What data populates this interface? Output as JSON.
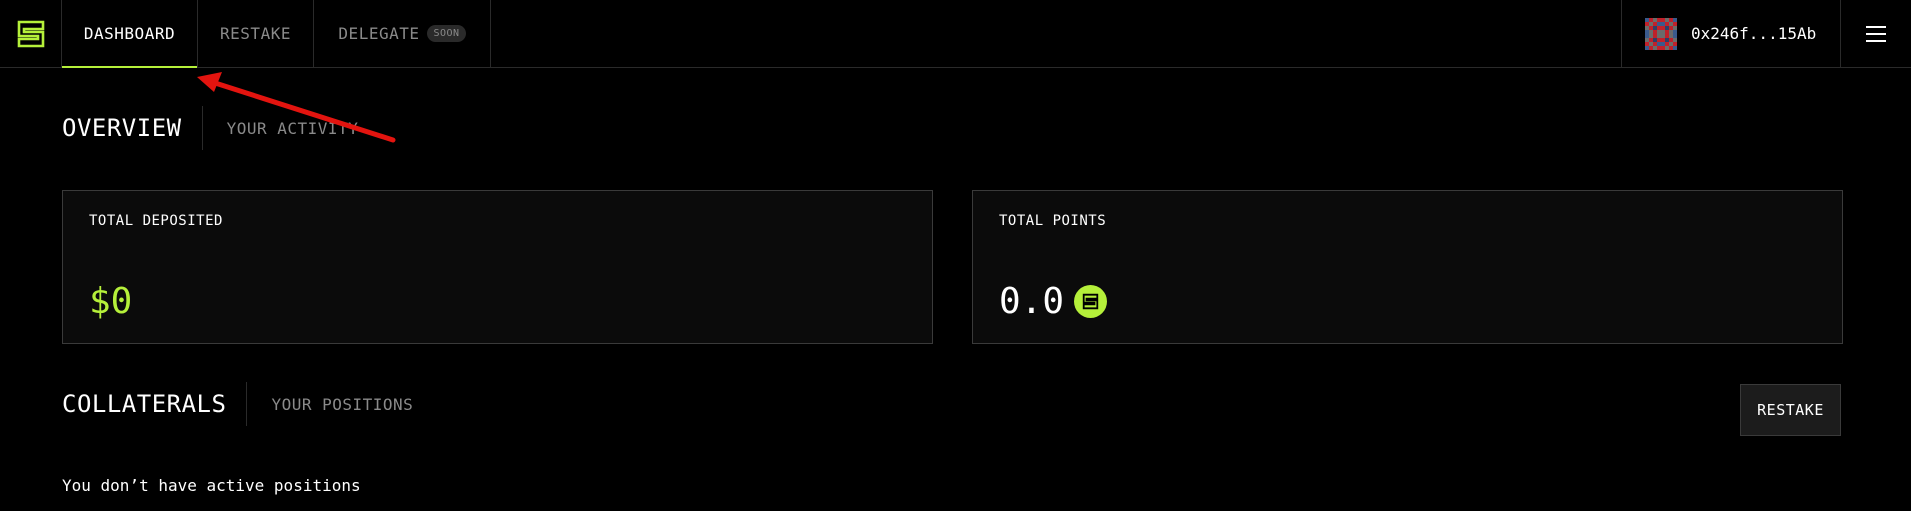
{
  "nav": {
    "tabs": [
      {
        "label": "DASHBOARD",
        "active": true
      },
      {
        "label": "RESTAKE",
        "active": false
      },
      {
        "label": "DELEGATE",
        "active": false,
        "badge": "SOON"
      }
    ],
    "wallet_address": "0x246f...15Ab",
    "logo_icon": "layers-logo-icon",
    "menu_icon": "hamburger-menu-icon"
  },
  "overview": {
    "title": "OVERVIEW",
    "subtitle": "YOUR ACTIVITY"
  },
  "cards": {
    "deposited": {
      "label": "TOTAL DEPOSITED",
      "value": "$0"
    },
    "points": {
      "label": "TOTAL POINTS",
      "value": "0.0"
    }
  },
  "collaterals": {
    "title": "COLLATERALS",
    "subtitle": "YOUR POSITIONS",
    "restake_label": "RESTAKE",
    "empty_message": "You don’t have active positions"
  },
  "colors": {
    "background": "#000000",
    "accent": "#b5f03a",
    "muted_text": "#8a8a8a",
    "border": "#2a2a2a",
    "annotation_arrow": "#e3140f"
  }
}
